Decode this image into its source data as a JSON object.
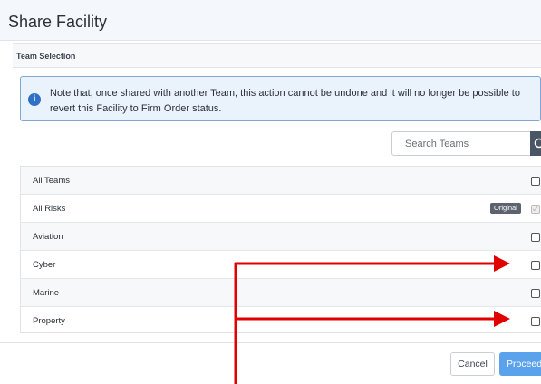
{
  "modal": {
    "title": "Share Facility",
    "section_label": "Team Selection",
    "info_text": "Note that, once shared with another Team, this action cannot be undone and it will no longer be possible to revert this Facility to Firm Order status.",
    "info_icon": "info-icon",
    "search": {
      "placeholder": "Search Teams",
      "value": "",
      "icon": "search-icon"
    },
    "teams": [
      {
        "label": "All Teams",
        "checked": false,
        "disabled": false,
        "badge": ""
      },
      {
        "label": "All Risks",
        "checked": true,
        "disabled": true,
        "badge": "Original"
      },
      {
        "label": "Aviation",
        "checked": false,
        "disabled": false,
        "badge": ""
      },
      {
        "label": "Cyber",
        "checked": false,
        "disabled": false,
        "badge": ""
      },
      {
        "label": "Marine",
        "checked": false,
        "disabled": false,
        "badge": ""
      },
      {
        "label": "Property",
        "checked": false,
        "disabled": false,
        "badge": ""
      }
    ],
    "buttons": {
      "cancel": "Cancel",
      "proceed": "Proceed"
    },
    "colors": {
      "accent": "#5ba2ec",
      "annotation": "#e00000",
      "info_bg": "#eaf2fb"
    }
  }
}
